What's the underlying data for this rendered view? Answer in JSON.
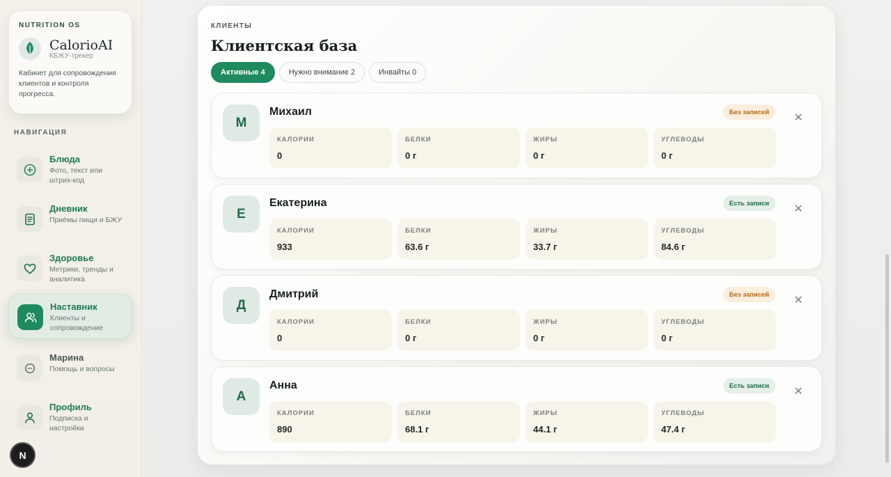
{
  "brand": {
    "kicker": "NUTRITION OS",
    "name": "CalorioAI",
    "subtitle": "КБЖУ-трекер",
    "description": "Кабинет для сопровождения клиентов и контроля прогресса."
  },
  "nav": {
    "heading": "НАВИГАЦИЯ",
    "items": [
      {
        "title": "Блюда",
        "desc": "Фото, текст или штрих-код",
        "icon": "plus-circle-icon"
      },
      {
        "title": "Дневник",
        "desc": "Приёмы пищи и БЖУ",
        "icon": "notebook-icon"
      },
      {
        "title": "Здоровье",
        "desc": "Метрики, тренды и аналитика",
        "icon": "heart-icon"
      },
      {
        "title": "Наставник",
        "desc": "Клиенты и сопровождение",
        "icon": "users-icon"
      },
      {
        "title": "Марина",
        "desc": "Помощь и вопросы",
        "icon": "chat-icon"
      },
      {
        "title": "Профиль",
        "desc": "Подписка и настройки",
        "icon": "user-icon"
      }
    ],
    "active_index": 3
  },
  "user_badge": "N",
  "panel": {
    "kicker": "КЛИЕНТЫ",
    "title": "Клиентская база",
    "tabs": [
      {
        "label": "Активные 4",
        "active": true
      },
      {
        "label": "Нужно внимание 2",
        "active": false
      },
      {
        "label": "Инвайты 0",
        "active": false
      }
    ]
  },
  "metric_labels": {
    "calories": "КАЛОРИИ",
    "protein": "БЕЛКИ",
    "fat": "ЖИРЫ",
    "carbs": "УГЛЕВОДЫ"
  },
  "clients": [
    {
      "initial": "М",
      "name": "Михаил",
      "status": "Без записей",
      "status_type": "none",
      "calories": "0",
      "protein": "0 г",
      "fat": "0 г",
      "carbs": "0 г"
    },
    {
      "initial": "Е",
      "name": "Екатерина",
      "status": "Есть записи",
      "status_type": "has",
      "calories": "933",
      "protein": "63.6 г",
      "fat": "33.7 г",
      "carbs": "84.6 г"
    },
    {
      "initial": "Д",
      "name": "Дмитрий",
      "status": "Без записей",
      "status_type": "none",
      "calories": "0",
      "protein": "0 г",
      "fat": "0 г",
      "carbs": "0 г"
    },
    {
      "initial": "А",
      "name": "Анна",
      "status": "Есть записи",
      "status_type": "has",
      "calories": "890",
      "protein": "68.1 г",
      "fat": "44.1 г",
      "carbs": "47.4 г"
    }
  ],
  "colors": {
    "accent": "#1f8a5e",
    "status_none_bg": "#fbeedd",
    "status_has_bg": "#e3efe7"
  }
}
